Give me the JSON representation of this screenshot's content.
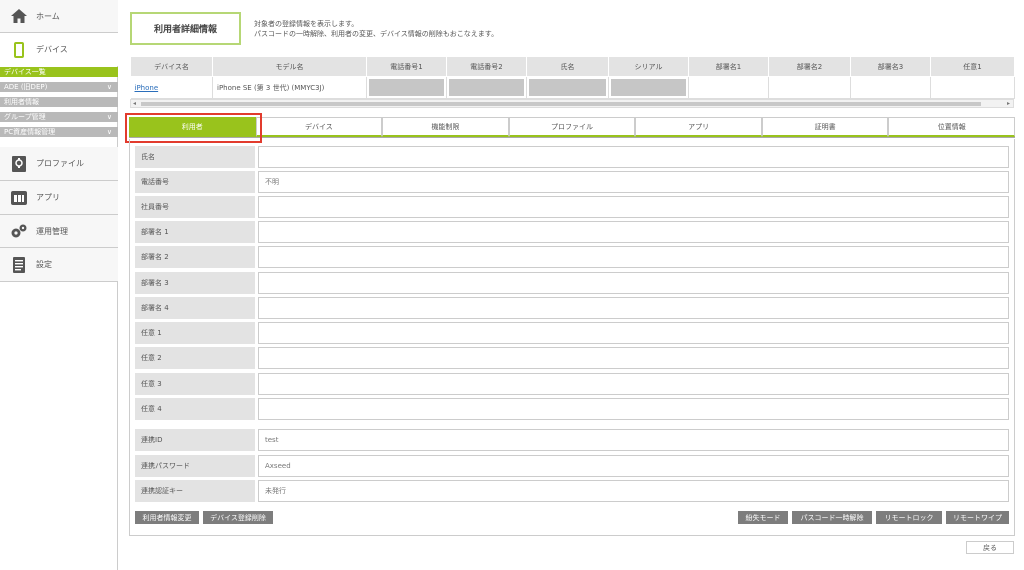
{
  "sidebar": {
    "home": "ホーム",
    "device": "デバイス",
    "sub_items": [
      "デバイス一覧",
      "ADE (旧DEP)",
      "利用者情報",
      "グループ管理",
      "PC資産情報管理"
    ],
    "profile": "プロファイル",
    "app": "アプリ",
    "ops": "運用管理",
    "settings": "設定"
  },
  "header": {
    "title": "利用者詳細情報",
    "desc_line1": "対象者の登録情報を表示します。",
    "desc_line2": "パスコードの一時解除、利用者の変更、デバイス情報の削除もおこなえます。"
  },
  "device_table": {
    "columns": [
      "デバイス名",
      "モデル名",
      "電話番号1",
      "電話番号2",
      "氏名",
      "シリアル",
      "部署名1",
      "部署名2",
      "部署名3",
      "任意1"
    ],
    "row": {
      "device_name": "iPhone",
      "model": "iPhone SE (第 3 世代) (MMYC3J)"
    }
  },
  "tabs": [
    "利用者",
    "デバイス",
    "機能制限",
    "プロファイル",
    "アプリ",
    "証明書",
    "位置情報"
  ],
  "form": {
    "fields": [
      {
        "label": "氏名",
        "value": ""
      },
      {
        "label": "電話番号",
        "value": "不明"
      },
      {
        "label": "社員番号",
        "value": ""
      },
      {
        "label": "部署名 1",
        "value": ""
      },
      {
        "label": "部署名 2",
        "value": ""
      },
      {
        "label": "部署名 3",
        "value": ""
      },
      {
        "label": "部署名 4",
        "value": ""
      },
      {
        "label": "任意 1",
        "value": ""
      },
      {
        "label": "任意 2",
        "value": ""
      },
      {
        "label": "任意 3",
        "value": ""
      },
      {
        "label": "任意 4",
        "value": ""
      }
    ],
    "link_fields": [
      {
        "label": "連携ID",
        "value": "test"
      },
      {
        "label": "連携パスワード",
        "value": "Axseed"
      },
      {
        "label": "連携認証キー",
        "value": "未発行"
      }
    ]
  },
  "buttons": {
    "edit_user": "利用者情報変更",
    "delete_device": "デバイス登録削除",
    "lost_mode": "紛失モード",
    "passcode_unlock": "パスコード一時解除",
    "remote_lock": "リモートロック",
    "remote_wipe": "リモートワイプ",
    "back": "戻る"
  },
  "colors": {
    "accent": "#99c31c",
    "highlight": "#e23b2d"
  }
}
